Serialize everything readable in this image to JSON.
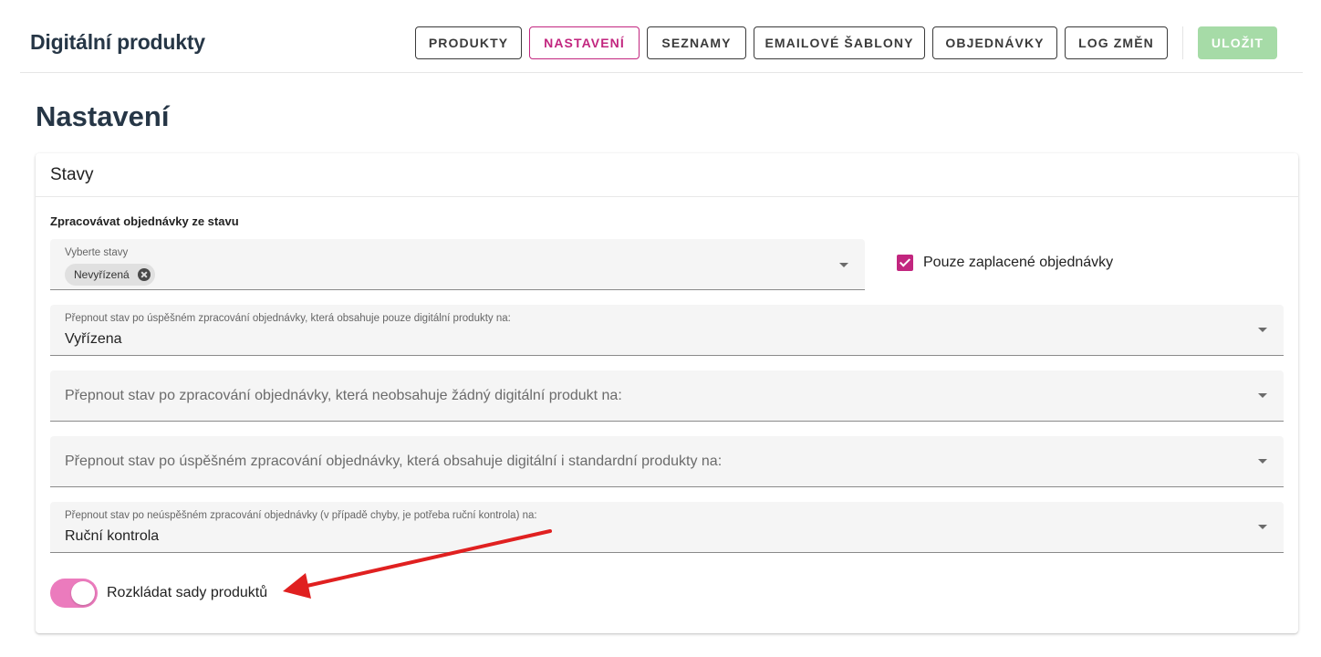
{
  "app": {
    "title": "Digitální produkty"
  },
  "nav": {
    "items": [
      {
        "label": "PRODUKTY"
      },
      {
        "label": "NASTAVENÍ"
      },
      {
        "label": "SEZNAMY"
      },
      {
        "label": "EMAILOVÉ ŠABLONY"
      },
      {
        "label": "OBJEDNÁVKY"
      },
      {
        "label": "LOG ZMĚN"
      }
    ],
    "active": "NASTAVENÍ",
    "save_label": "ULOŽIT"
  },
  "page": {
    "title": "Nastavení"
  },
  "card": {
    "title": "Stavy",
    "process_label": "Zpracovávat objednávky ze stavu",
    "states_select": {
      "label": "Vyberte stavy",
      "chips": [
        "Nevyřízená"
      ]
    },
    "paid_only": {
      "label": "Pouze zaplacené objednávky",
      "checked": true
    },
    "select_digital_only": {
      "label": "Přepnout stav po úspěšném zpracování objednávky, která obsahuje pouze digitální produkty na:",
      "value": "Vyřízena"
    },
    "select_no_digital": {
      "placeholder": "Přepnout stav po zpracování objednávky, která neobsahuje žádný digitální produkt na:"
    },
    "select_mixed": {
      "placeholder": "Přepnout stav po úspěšném zpracování objednávky, která obsahuje digitální i standardní produkty na:"
    },
    "select_failed": {
      "label": "Přepnout stav po neúspěšném zpracování objednávky (v případě chyby, je potřeba ruční kontrola) na:",
      "value": "Ruční kontrola"
    },
    "split_bundles": {
      "label": "Rozkládat sady produktů",
      "on": true
    }
  },
  "colors": {
    "accent": "#c2267f",
    "toggle": "#eb7bbd",
    "save_button": "#a6dba7",
    "annotation_arrow": "#e02020",
    "heading": "#263646"
  }
}
